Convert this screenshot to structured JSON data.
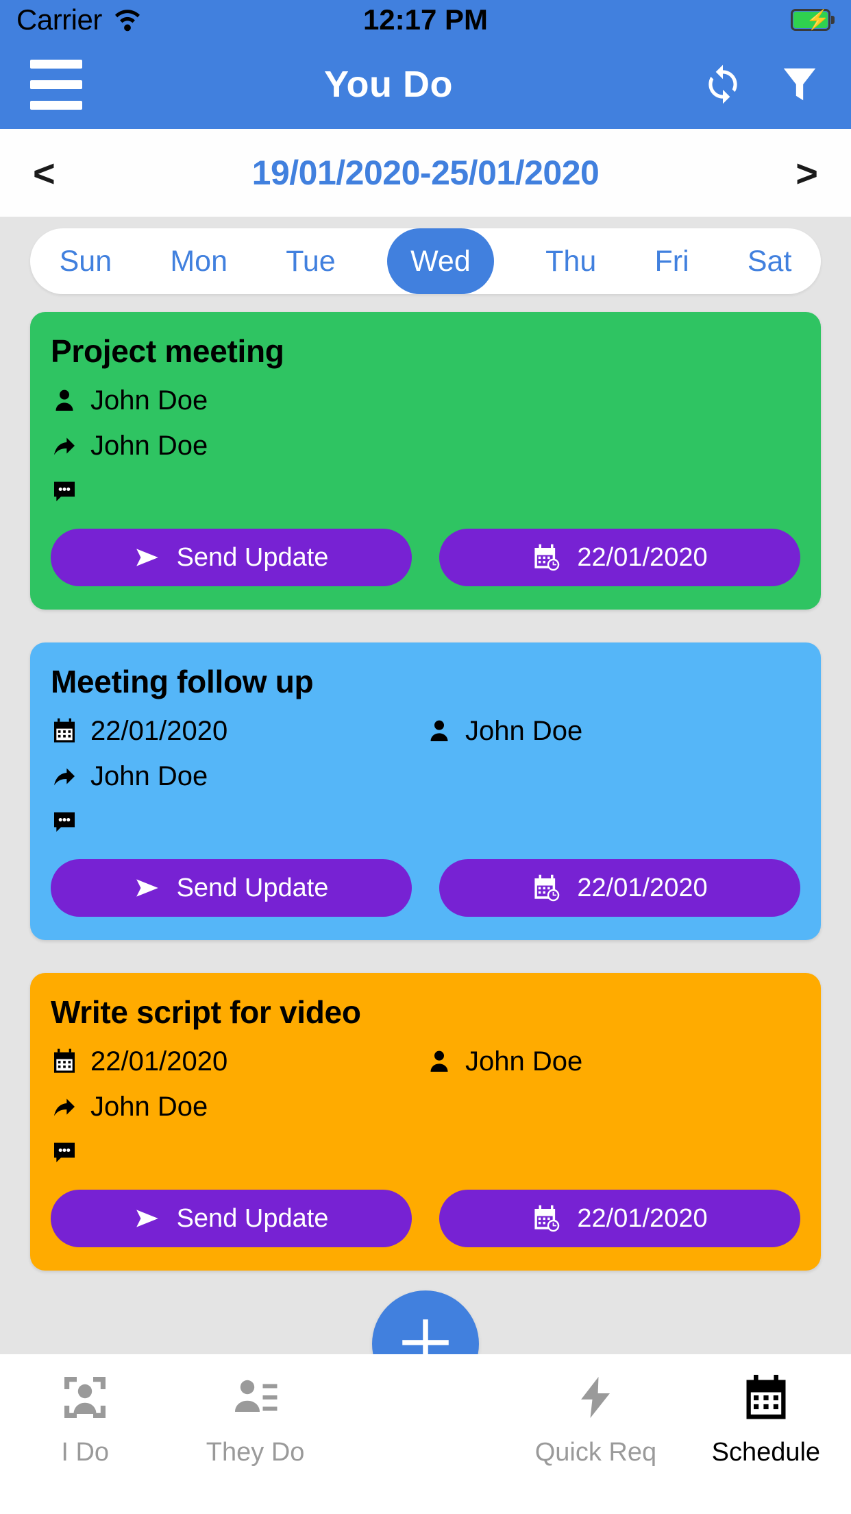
{
  "status_bar": {
    "carrier": "Carrier",
    "time": "12:17 PM",
    "wifi_icon": "wifi-icon",
    "battery_icon": "battery-charging-icon"
  },
  "nav_bar": {
    "menu_icon": "hamburger-menu-icon",
    "title": "You Do",
    "refresh_icon": "sync-refresh-icon",
    "filter_icon": "filter-funnel-icon"
  },
  "week_nav": {
    "prev_label": "<",
    "next_label": ">",
    "range": "19/01/2020-25/01/2020"
  },
  "day_selector": {
    "days": [
      {
        "label": "Sun",
        "active": false
      },
      {
        "label": "Mon",
        "active": false
      },
      {
        "label": "Tue",
        "active": false
      },
      {
        "label": "Wed",
        "active": true
      },
      {
        "label": "Thu",
        "active": false
      },
      {
        "label": "Fri",
        "active": false
      },
      {
        "label": "Sat",
        "active": false
      }
    ]
  },
  "tasks": [
    {
      "title": "Project meeting",
      "color": "#2fc462",
      "rows": [
        {
          "icon": "person-icon",
          "text": "John Doe",
          "column": "left"
        },
        {
          "icon": "share-arrow-icon",
          "text": "John Doe",
          "column": "left"
        },
        {
          "icon": "comment-dots-icon",
          "text": "",
          "column": "left"
        }
      ],
      "send_button": {
        "label": "Send Update",
        "icon": "send-plane-icon"
      },
      "date_button": {
        "label": "22/01/2020",
        "icon": "calendar-clock-icon"
      }
    },
    {
      "title": "Meeting follow up",
      "color": "#55b6f8",
      "rows": [
        {
          "icon": "calendar-icon",
          "text": "22/01/2020",
          "column": "left"
        },
        {
          "icon": "person-icon",
          "text": "John Doe",
          "column": "right"
        },
        {
          "icon": "share-arrow-icon",
          "text": "John Doe",
          "column": "left"
        },
        {
          "icon": "comment-dots-icon",
          "text": "",
          "column": "left"
        }
      ],
      "send_button": {
        "label": "Send Update",
        "icon": "send-plane-icon"
      },
      "date_button": {
        "label": "22/01/2020",
        "icon": "calendar-clock-icon"
      }
    },
    {
      "title": "Write script for video",
      "color": "#ffab00",
      "rows": [
        {
          "icon": "calendar-icon",
          "text": "22/01/2020",
          "column": "left"
        },
        {
          "icon": "person-icon",
          "text": "John Doe",
          "column": "right"
        },
        {
          "icon": "share-arrow-icon",
          "text": "John Doe",
          "column": "left"
        },
        {
          "icon": "comment-dots-icon",
          "text": "",
          "column": "left"
        }
      ],
      "send_button": {
        "label": "Send Update",
        "icon": "send-plane-icon"
      },
      "date_button": {
        "label": "22/01/2020",
        "icon": "calendar-clock-icon"
      }
    }
  ],
  "fab": {
    "icon": "plus-icon"
  },
  "tab_bar": {
    "tabs": [
      {
        "label": "I Do",
        "icon": "person-frame-icon",
        "active": false
      },
      {
        "label": "They Do",
        "icon": "person-list-icon",
        "active": false
      },
      {
        "label": "Quick Req",
        "icon": "lightning-bolt-icon",
        "active": false
      },
      {
        "label": "Schedule",
        "icon": "calendar-schedule-icon",
        "active": true
      }
    ]
  },
  "colors": {
    "header_blue": "#4180de",
    "accent_purple": "#7722d3",
    "card_green": "#2fc462",
    "card_blue": "#55b6f8",
    "card_orange": "#ffab00",
    "page_bg": "#e4e4e4"
  }
}
